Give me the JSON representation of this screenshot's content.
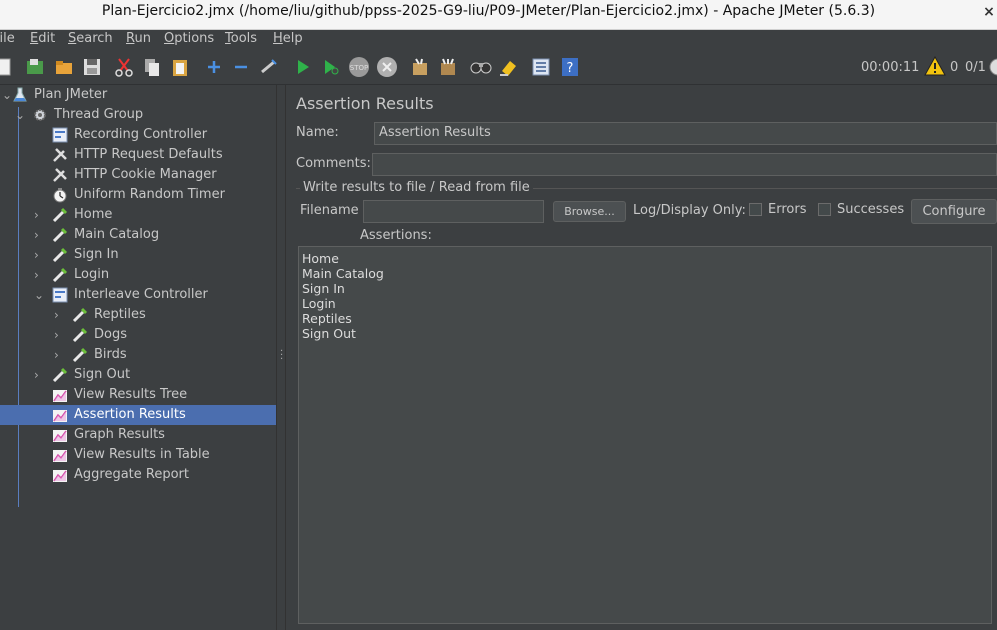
{
  "window": {
    "title": "Plan-Ejercicio2.jmx (/home/liu/github/ppss-2025-G9-liu/P09-JMeter/Plan-Ejercicio2.jmx) - Apache JMeter (5.6.3)",
    "close_glyph": "×"
  },
  "menu": {
    "file": "File",
    "edit": "Edit",
    "search": "Search",
    "run": "Run",
    "options": "Options",
    "tools": "Tools",
    "help": "Help"
  },
  "toolbar": {
    "timer": "00:00:11",
    "warnings": "0",
    "threads": "0/1",
    "stop_label": "STOP"
  },
  "tree": {
    "plan": "Plan JMeter",
    "thread_group": "Thread Group",
    "items": [
      {
        "label": "Recording Controller",
        "icon": "controller-icon"
      },
      {
        "label": "HTTP Request Defaults",
        "icon": "wrench-icon"
      },
      {
        "label": "HTTP Cookie Manager",
        "icon": "wrench-icon"
      },
      {
        "label": "Uniform Random Timer",
        "icon": "timer-icon"
      },
      {
        "label": "Home",
        "icon": "sampler-icon"
      },
      {
        "label": "Main Catalog",
        "icon": "sampler-icon"
      },
      {
        "label": "Sign In",
        "icon": "sampler-icon"
      },
      {
        "label": "Login",
        "icon": "sampler-icon"
      },
      {
        "label": "Interleave Controller",
        "icon": "controller-icon"
      },
      {
        "label": "Reptiles",
        "icon": "sampler-icon"
      },
      {
        "label": "Dogs",
        "icon": "sampler-icon"
      },
      {
        "label": "Birds",
        "icon": "sampler-icon"
      },
      {
        "label": "Sign Out",
        "icon": "sampler-icon"
      },
      {
        "label": "View Results Tree",
        "icon": "listener-icon"
      },
      {
        "label": "Assertion Results",
        "icon": "listener-icon"
      },
      {
        "label": "Graph Results",
        "icon": "listener-icon"
      },
      {
        "label": "View Results in Table",
        "icon": "listener-icon"
      },
      {
        "label": "Aggregate Report",
        "icon": "listener-icon"
      }
    ]
  },
  "panel": {
    "title": "Assertion Results",
    "name_label": "Name:",
    "name_value": "Assertion Results",
    "comments_label": "Comments:",
    "comments_value": "",
    "file_group": "Write results to file / Read from file",
    "filename_label": "Filename",
    "filename_value": "",
    "browse": "Browse...",
    "log_display": "Log/Display Only:",
    "errors": "Errors",
    "successes": "Successes",
    "configure": "Configure",
    "assertions_label": "Assertions:",
    "assertions": [
      "Home",
      "Main Catalog",
      "Sign In",
      "Login",
      "Reptiles",
      "Sign Out"
    ]
  }
}
